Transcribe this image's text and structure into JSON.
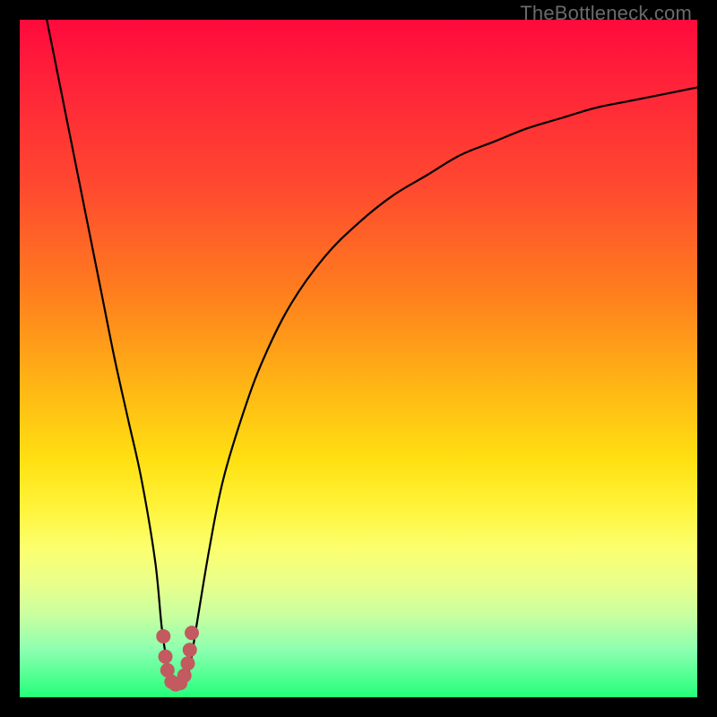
{
  "watermark": "TheBottleneck.com",
  "colors": {
    "frame": "#000000",
    "curve": "#000000",
    "marker": "#c25a5f",
    "gradient_stops": [
      "#ff0a3c",
      "#ff1f3a",
      "#ff4a2f",
      "#ff7d1e",
      "#ffb914",
      "#ffe012",
      "#fff43a",
      "#fcff6e",
      "#eaff8a",
      "#c8ffa0",
      "#8cffb0",
      "#24ff7a"
    ]
  },
  "chart_data": {
    "type": "line",
    "title": "",
    "xlabel": "",
    "ylabel": "",
    "xlim": [
      0,
      100
    ],
    "ylim": [
      0,
      100
    ],
    "series": [
      {
        "name": "bottleneck-curve",
        "x": [
          4,
          6,
          8,
          10,
          12,
          14,
          16,
          18,
          20,
          21,
          22,
          23,
          24,
          25,
          26,
          28,
          30,
          33,
          36,
          40,
          45,
          50,
          55,
          60,
          65,
          70,
          75,
          80,
          85,
          90,
          95,
          100
        ],
        "y": [
          100,
          90,
          80,
          70,
          60,
          50,
          41,
          32,
          20,
          10,
          4,
          2,
          2,
          4,
          10,
          22,
          32,
          42,
          50,
          58,
          65,
          70,
          74,
          77,
          80,
          82,
          84,
          85.5,
          87,
          88,
          89,
          90
        ]
      }
    ],
    "markers": {
      "name": "highlighted-minimum",
      "x": [
        21.2,
        21.5,
        21.8,
        22.4,
        23.0,
        23.7,
        24.3,
        24.8,
        25.1,
        25.4
      ],
      "y": [
        9.0,
        6.0,
        4.0,
        2.3,
        1.9,
        2.1,
        3.2,
        5.0,
        7.0,
        9.5
      ]
    }
  }
}
